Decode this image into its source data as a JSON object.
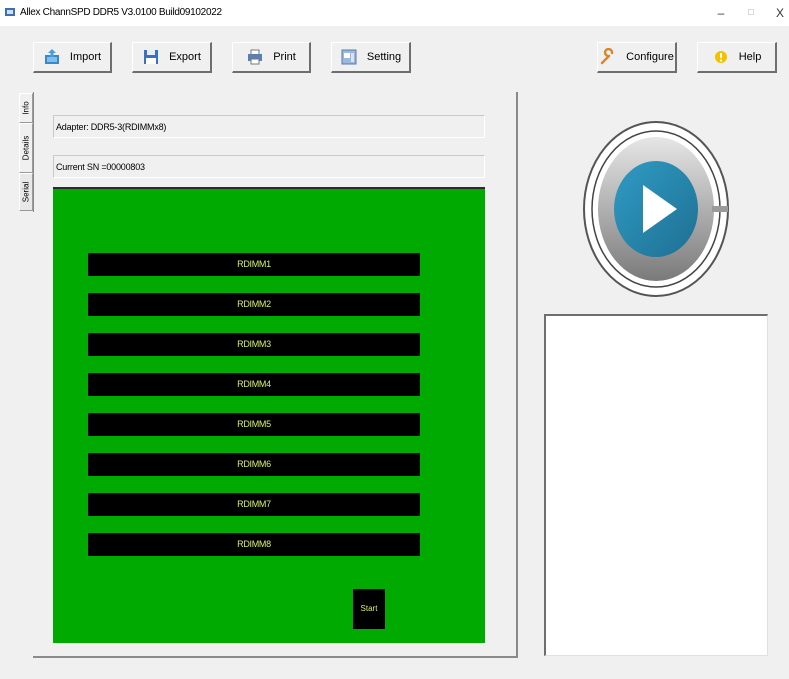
{
  "window": {
    "title": "Allex ChannSPD DDR5 V3.0100 Build09102022",
    "minimize": "–",
    "maximize": "□",
    "close": "X"
  },
  "toolbar": {
    "import_label": "Import",
    "export_label": "Export",
    "print_label": "Print",
    "setting_label": "Setting",
    "configure_label": "Configure",
    "help_label": "Help"
  },
  "side_tabs": [
    "Info",
    "Details",
    "Serial"
  ],
  "fields": {
    "adapter": "Adapter: DDR5-3(RDIMMx8)",
    "current_sn": "Current SN =00000803"
  },
  "slots": [
    "RDIMM1",
    "RDIMM2",
    "RDIMM3",
    "RDIMM4",
    "RDIMM5",
    "RDIMM6",
    "RDIMM7",
    "RDIMM8"
  ],
  "start_label": "Start",
  "colors": {
    "board_green": "#00aa00",
    "slot_black": "#000000",
    "slot_text": "#d6f06a",
    "play_blue": "#2a8db0"
  }
}
